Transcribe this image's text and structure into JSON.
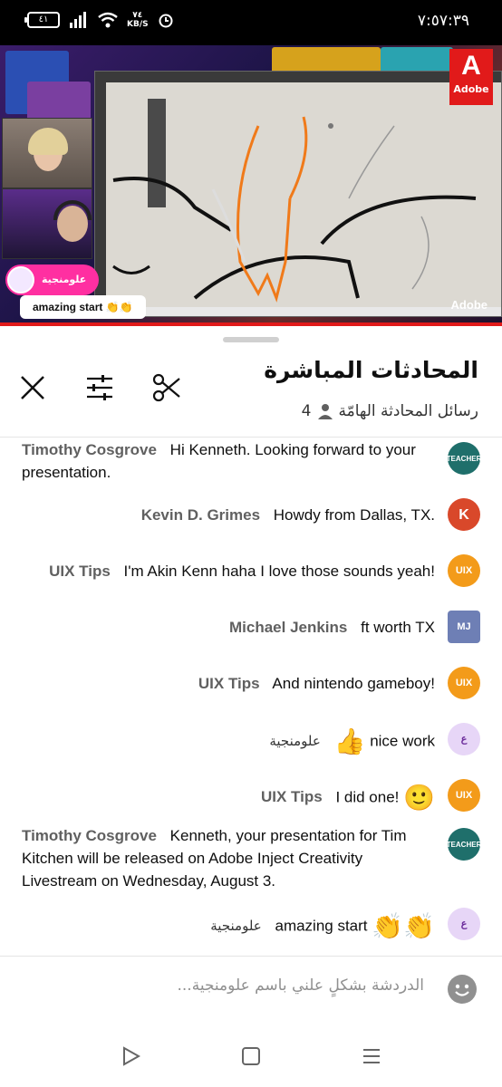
{
  "status": {
    "time": "٧:٥٧:٣٩",
    "battery": "٤١",
    "speed_value": "٧٤",
    "speed_unit": "KB/S"
  },
  "video": {
    "overlay_name": "علومنجية",
    "overlay_message": "amazing start 👏👏",
    "brand": "Adobe",
    "brand_mark": "A"
  },
  "chat": {
    "title": "المحادثات المباشرة",
    "subtitle": "رسائل المحادثة الهامّة",
    "viewers": "4",
    "input_placeholder": "الدردشة بشكلٍ علني باسم علومنجية..."
  },
  "messages": [
    {
      "author": "Timothy Cosgrove",
      "text": "Hi Kenneth. Looking forward to your presentation.",
      "avatar": "TEACHER",
      "avatar_color": "#1f6f6b"
    },
    {
      "author": "Kevin D. Grimes",
      "text": "Howdy from Dallas, TX.",
      "avatar": "K",
      "avatar_color": "#d9482a"
    },
    {
      "author": "UIX Tips",
      "text": "I'm Akin Kenn haha I love those sounds yeah!",
      "avatar": "UIX",
      "avatar_color": "#f39b1a"
    },
    {
      "author": "Michael Jenkins",
      "text": "ft worth TX",
      "avatar": "MJ",
      "avatar_color": "#6e7fb5"
    },
    {
      "author": "UIX Tips",
      "text": "And nintendo gameboy!",
      "avatar": "UIX",
      "avatar_color": "#f39b1a"
    },
    {
      "author": "علومنجية",
      "text": "nice work",
      "emoji": "👍",
      "avatar": "ع",
      "avatar_color": "#e7d6f7"
    },
    {
      "author": "UIX Tips",
      "text": "I did one!",
      "emoji": "🙂",
      "avatar": "UIX",
      "avatar_color": "#f39b1a"
    },
    {
      "author": "Timothy Cosgrove",
      "text": "Kenneth, your presentation for Tim Kitchen will be released on Adobe Inject Creativity Livestream on Wednesday, August 3.",
      "avatar": "TEACHER",
      "avatar_color": "#1f6f6b"
    },
    {
      "author": "علومنجية",
      "text": "amazing start",
      "emoji": "👏👏",
      "avatar": "ع",
      "avatar_color": "#e7d6f7"
    }
  ]
}
